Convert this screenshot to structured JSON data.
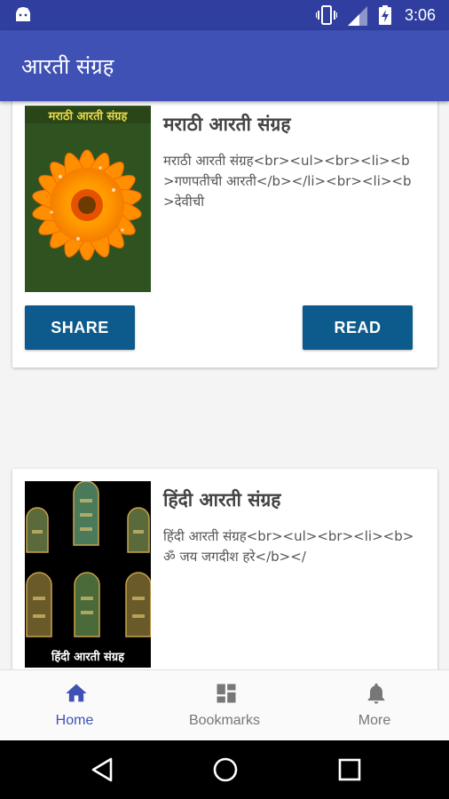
{
  "status_bar": {
    "time": "3:06",
    "icons": [
      "android-icon",
      "vibrate-icon",
      "signal-icon",
      "battery-charging-icon"
    ]
  },
  "app_bar": {
    "title": "आरती संग्रह"
  },
  "cards": [
    {
      "image_caption": "मराठी आरती संग्रह",
      "title": "मराठी आरती संग्रह",
      "description": "मराठी आरती संग्रह<br><ul><br><li><b>गणपतीची आरती</b></li><br><li><b>देवीची",
      "share_label": "SHARE",
      "read_label": "READ"
    },
    {
      "image_caption": "हिंदी आरती संग्रह",
      "title": "हिंदी आरती संग्रह",
      "description": "हिंदी आरती संग्रह<br><ul><br><li><b>ॐ जय जगदीश हरे</b></"
    }
  ],
  "bottom_nav": {
    "items": [
      {
        "label": "Home",
        "icon": "home-icon",
        "active": true
      },
      {
        "label": "Bookmarks",
        "icon": "dashboard-icon",
        "active": false
      },
      {
        "label": "More",
        "icon": "bell-icon",
        "active": false
      }
    ],
    "active_color": "#3f51b5",
    "inactive_color": "#777777"
  },
  "colors": {
    "status_bar": "#303f9f",
    "app_bar": "#3f51b5",
    "button": "#0d5a8c"
  }
}
